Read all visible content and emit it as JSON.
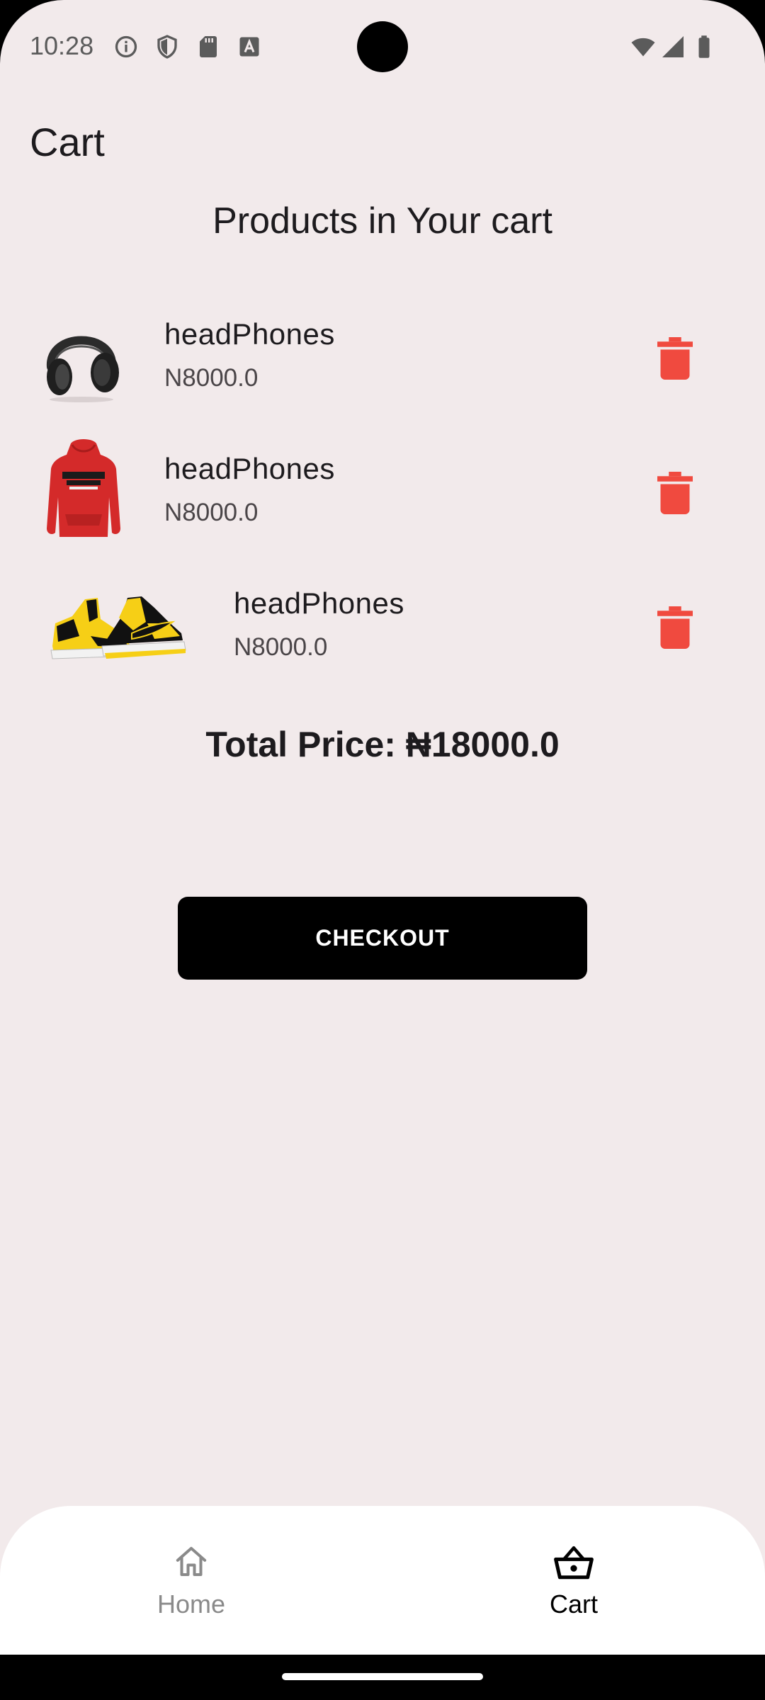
{
  "status_bar": {
    "time": "10:28",
    "left_icons": [
      "info-icon",
      "shield-icon",
      "sd-card-icon",
      "keyboard-a-icon"
    ],
    "right_icons": [
      "wifi-icon",
      "signal-icon",
      "battery-icon"
    ]
  },
  "app_bar": {
    "title": "Cart"
  },
  "heading": "Products in Your cart",
  "cart": {
    "items": [
      {
        "image": "headphones-image",
        "name": "headPhones",
        "price": "N8000.0"
      },
      {
        "image": "red-hoodie-image",
        "name": "headPhones",
        "price": "N8000.0"
      },
      {
        "image": "yellow-sneakers-image",
        "name": "headPhones",
        "price": "N8000.0"
      }
    ],
    "delete_icon": "trash-icon",
    "delete_color": "#f04a3f"
  },
  "total_price": "Total Price: ₦18000.0",
  "checkout_label": "CHECKOUT",
  "bottom_nav": {
    "items": [
      {
        "label": "Home",
        "icon": "home-icon",
        "active": false
      },
      {
        "label": "Cart",
        "icon": "basket-icon",
        "active": true
      }
    ],
    "active_color": "#000000",
    "inactive_color": "#8a8a8a"
  },
  "colors": {
    "background": "#f2eaeb",
    "accent": "#000000"
  }
}
